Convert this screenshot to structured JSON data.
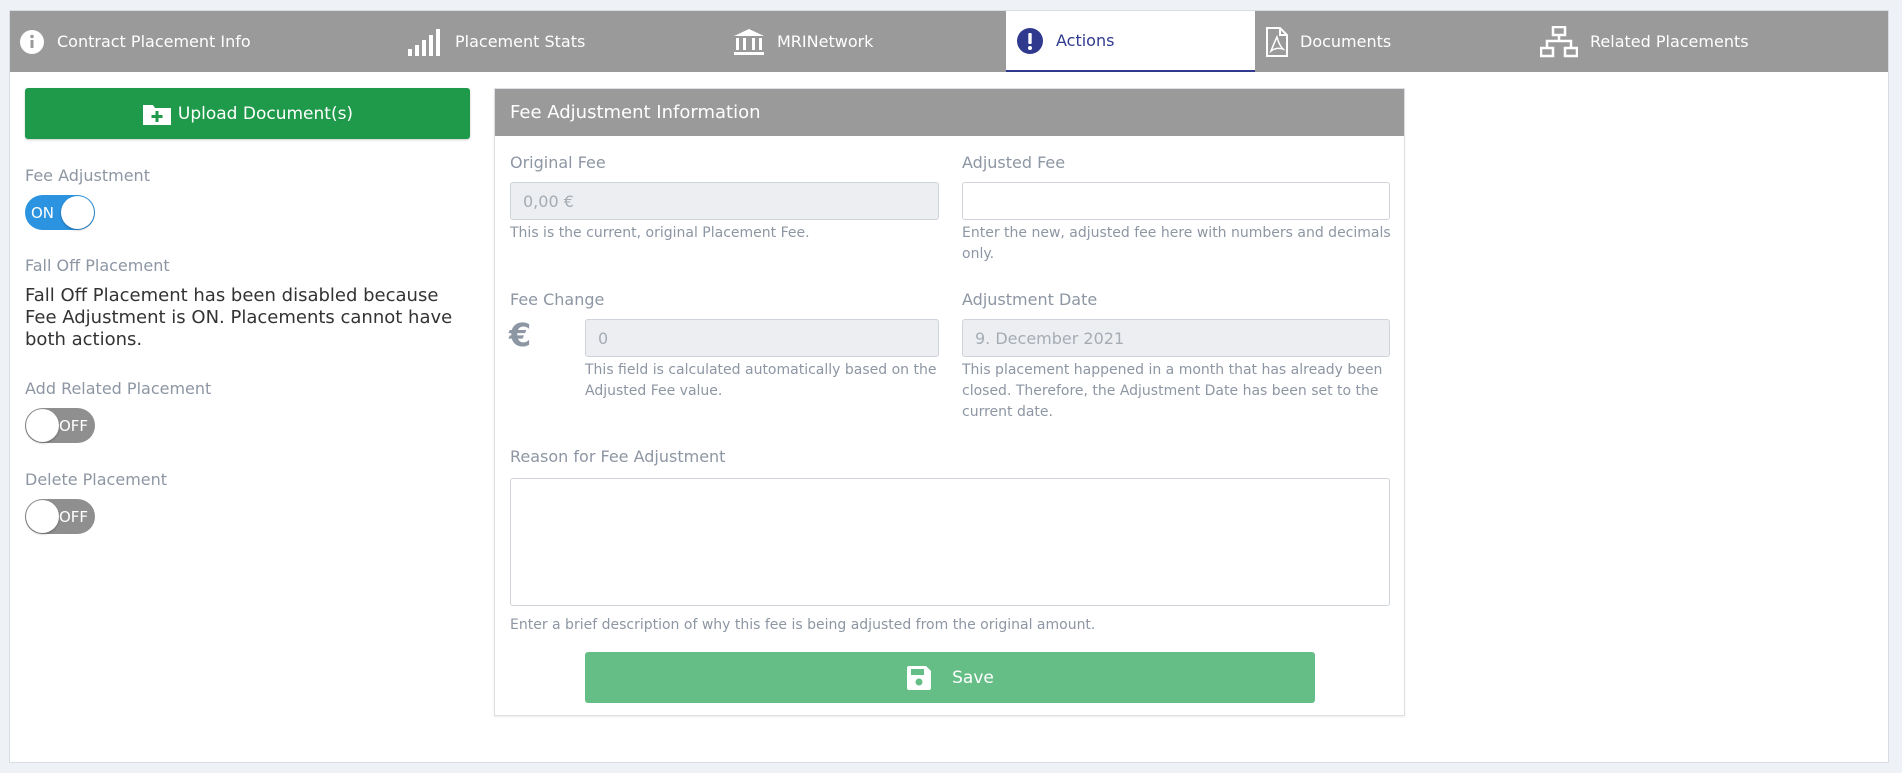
{
  "tabs": [
    {
      "label": "Contract Placement Info",
      "icon": "info-circle-icon"
    },
    {
      "label": "Placement Stats",
      "icon": "bar-chart-icon"
    },
    {
      "label": "MRINetwork",
      "icon": "bank-icon"
    },
    {
      "label": "Actions",
      "icon": "exclamation-circle-icon"
    },
    {
      "label": "Documents",
      "icon": "pdf-file-icon"
    },
    {
      "label": "Related Placements",
      "icon": "sitemap-icon"
    }
  ],
  "active_tab": "Actions",
  "left": {
    "upload_label": "Upload Document(s)",
    "fee_adjustment_label": "Fee Adjustment",
    "fee_adjustment_state": "ON",
    "fall_off_label": "Fall Off Placement",
    "fall_off_message": "Fall Off Placement has been disabled because Fee Adjustment is ON. Placements cannot have both actions.",
    "related_label": "Add Related Placement",
    "related_state": "OFF",
    "delete_label": "Delete Placement",
    "delete_state": "OFF"
  },
  "card": {
    "title": "Fee Adjustment Information",
    "original_fee_label": "Original Fee",
    "original_fee_value": "0,00 €",
    "original_fee_help": "This is the current, original Placement Fee.",
    "adjusted_fee_label": "Adjusted Fee",
    "adjusted_fee_value": "",
    "adjusted_fee_help": "Enter the new, adjusted fee here with numbers and decimals only.",
    "fee_change_label": "Fee Change",
    "currency_symbol": "€",
    "fee_change_value": "0",
    "fee_change_help": "This field is calculated automatically based on the Adjusted Fee value.",
    "adjustment_date_label": "Adjustment Date",
    "adjustment_date_value": "9. December 2021",
    "adjustment_date_help": "This placement happened in a month that has already been closed. Therefore, the Adjustment Date has been set to the current date.",
    "reason_label": "Reason for Fee Adjustment",
    "reason_value": "",
    "reason_help": "Enter a brief description of why this fee is being adjusted from the original amount.",
    "save_label": "Save"
  },
  "colors": {
    "tab_bar": "#9a9a9a",
    "active_tab_text": "#2f3a8f",
    "upload_button": "#1f9a4a",
    "save_button": "#66be87",
    "toggle_on": "#2b93e0",
    "toggle_off": "#8f8f8f"
  }
}
